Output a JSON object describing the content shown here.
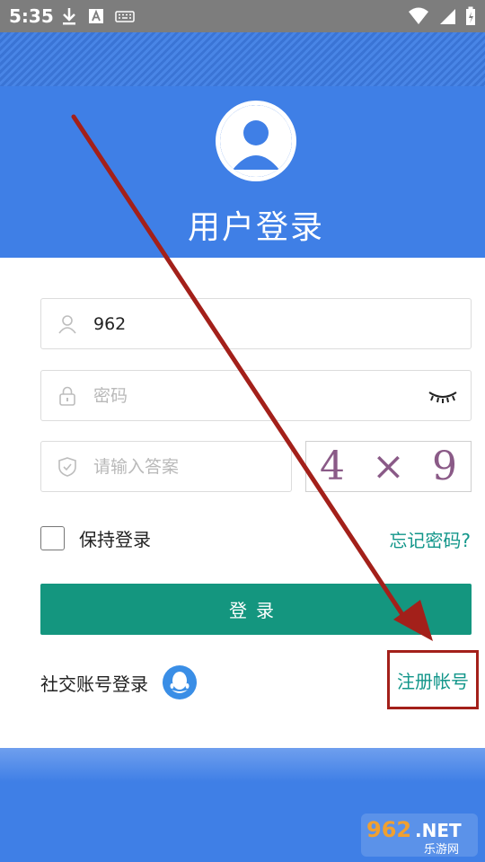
{
  "status_bar": {
    "time": "5:35"
  },
  "header": {
    "title": "用户登录"
  },
  "form": {
    "username": {
      "value": "962",
      "placeholder": ""
    },
    "password": {
      "value": "",
      "placeholder": "密码"
    },
    "answer": {
      "value": "",
      "placeholder": "请输入答案"
    },
    "captcha": {
      "left": "4",
      "op": "×",
      "right": "9"
    },
    "remember_label": "保持登录",
    "forgot_label": "忘记密码?",
    "login_label": "登录"
  },
  "social": {
    "label": "社交账号登录",
    "register_label": "注册帐号"
  },
  "colors": {
    "header_blue": "#3f7fe6",
    "button_teal": "#14967f",
    "link_teal": "#12968a",
    "annotation_red": "#a3201a"
  },
  "watermark": {
    "brand": "962",
    "domain": ".NET",
    "cn": "乐游网"
  }
}
